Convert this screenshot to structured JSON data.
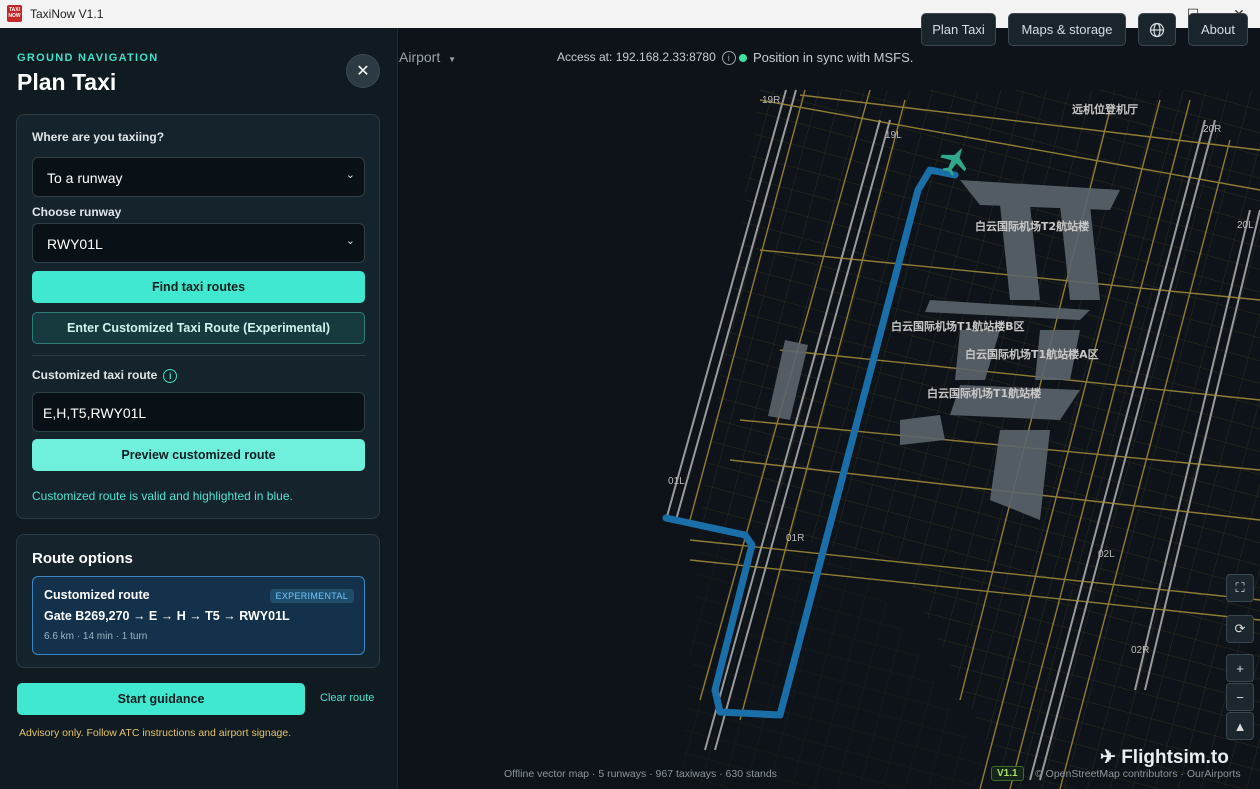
{
  "window": {
    "title": "TaxiNow V1.1",
    "icon_text": "TAXI NOW",
    "minimize_icon": "minimize-icon",
    "maximize_icon": "maximize-icon",
    "close_icon": "close-icon"
  },
  "panel": {
    "eyebrow": "GROUND NAVIGATION",
    "title": "Plan Taxi",
    "close_icon": "close-icon",
    "destination_label": "Where are you taxiing?",
    "destination_value": "To a runway",
    "runway_label": "Choose runway",
    "runway_value": "RWY01L",
    "find_routes_label": "Find taxi routes",
    "enter_custom_label": "Enter Customized Taxi Route (Experimental)",
    "custom_route_label": "Customized taxi route",
    "custom_route_value": "E,H,T5,RWY01L",
    "preview_label": "Preview customized route",
    "valid_message": "Customized route is valid and highlighted in blue."
  },
  "route_options": {
    "title": "Route options",
    "route": {
      "name": "Customized route",
      "badge": "EXPERIMENTAL",
      "path": "Gate B269,270 → E → H → T5 → RWY01L",
      "meta": "6.6 km · 14 min · 1 turn"
    }
  },
  "actions": {
    "start_label": "Start guidance",
    "clear_label": "Clear route",
    "advisory": "Advisory only. Follow ATC instructions and airport signage."
  },
  "toolbar": {
    "airport_label": "Airport",
    "access_text": "Access at: 192.168.2.33:8780",
    "sync_text": "Position in sync with MSFS.",
    "sync_color": "#3fe0a0",
    "plan_taxi_label": "Plan Taxi",
    "maps_label": "Maps & storage",
    "globe_icon": "globe-icon",
    "about_label": "About"
  },
  "map": {
    "labels": {
      "t2": "白云国际机场T2航站楼",
      "t1b": "白云国际机场T1航站楼B区",
      "t1a": "白云国际机场T1航站楼A区",
      "t1": "白云国际机场T1航站楼",
      "remote": "远机位登机厅"
    },
    "runways": {
      "r19r": "19R",
      "r19l": "19L",
      "r20r": "20R",
      "r20l": "20L",
      "r01l": "01L",
      "r01r": "01R",
      "r02l": "02L",
      "r02r": "02R"
    },
    "route_color": "#1a6fa8",
    "aircraft_color": "#2fa88c"
  },
  "status": {
    "map_info": "Offline vector map · 5 runways · 967 taxiways · 630 stands",
    "version": "V1.1",
    "attribution": "© OpenStreetMap contributors · OurAirports",
    "watermark": "Flightsim.to"
  }
}
